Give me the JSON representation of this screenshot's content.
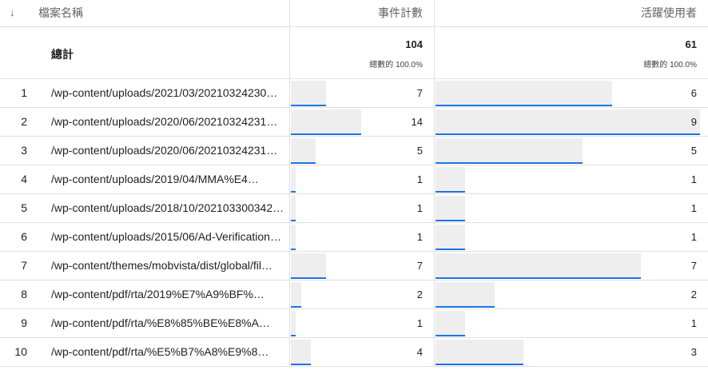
{
  "header": {
    "sort_icon": "↓",
    "file_name": "檔案名稱",
    "event_count": "事件計數",
    "active_users": "活躍使用者"
  },
  "total": {
    "label": "總計",
    "event_count": "104",
    "event_pct": "總數的 100.0%",
    "active_users": "61",
    "users_pct": "總數的 100.0%"
  },
  "rows": [
    {
      "idx": "1",
      "name": "/wp-content/uploads/2021/03/20210324230…",
      "events": "7",
      "users": "6",
      "events_frac": 0.5,
      "users_frac": 0.6667
    },
    {
      "idx": "2",
      "name": "/wp-content/uploads/2020/06/20210324231…",
      "events": "14",
      "users": "9",
      "events_frac": 1.0,
      "users_frac": 1.0
    },
    {
      "idx": "3",
      "name": "/wp-content/uploads/2020/06/20210324231…",
      "events": "5",
      "users": "5",
      "events_frac": 0.3571,
      "users_frac": 0.5556
    },
    {
      "idx": "4",
      "name": "/wp-content/uploads/2019/04/MMA%E4…",
      "events": "1",
      "users": "1",
      "events_frac": 0.0714,
      "users_frac": 0.1111
    },
    {
      "idx": "5",
      "name": "/wp-content/uploads/2018/10/202103300342…",
      "events": "1",
      "users": "1",
      "events_frac": 0.0714,
      "users_frac": 0.1111
    },
    {
      "idx": "6",
      "name": "/wp-content/uploads/2015/06/Ad-Verification-…",
      "events": "1",
      "users": "1",
      "events_frac": 0.0714,
      "users_frac": 0.1111
    },
    {
      "idx": "7",
      "name": "/wp-content/themes/mobvista/dist/global/fil…",
      "events": "7",
      "users": "7",
      "events_frac": 0.5,
      "users_frac": 0.7778
    },
    {
      "idx": "8",
      "name": "/wp-content/pdf/rta/2019%E7%A9%BF%…",
      "events": "2",
      "users": "2",
      "events_frac": 0.1429,
      "users_frac": 0.2222
    },
    {
      "idx": "9",
      "name": "/wp-content/pdf/rta/%E8%85%BE%E8%A…",
      "events": "1",
      "users": "1",
      "events_frac": 0.0714,
      "users_frac": 0.1111
    },
    {
      "idx": "10",
      "name": "/wp-content/pdf/rta/%E5%B7%A8%E9%8…",
      "events": "4",
      "users": "3",
      "events_frac": 0.2857,
      "users_frac": 0.3333
    }
  ],
  "colors": {
    "bar_fill": "#eeeeee",
    "bar_accent": "#1a73e8"
  }
}
